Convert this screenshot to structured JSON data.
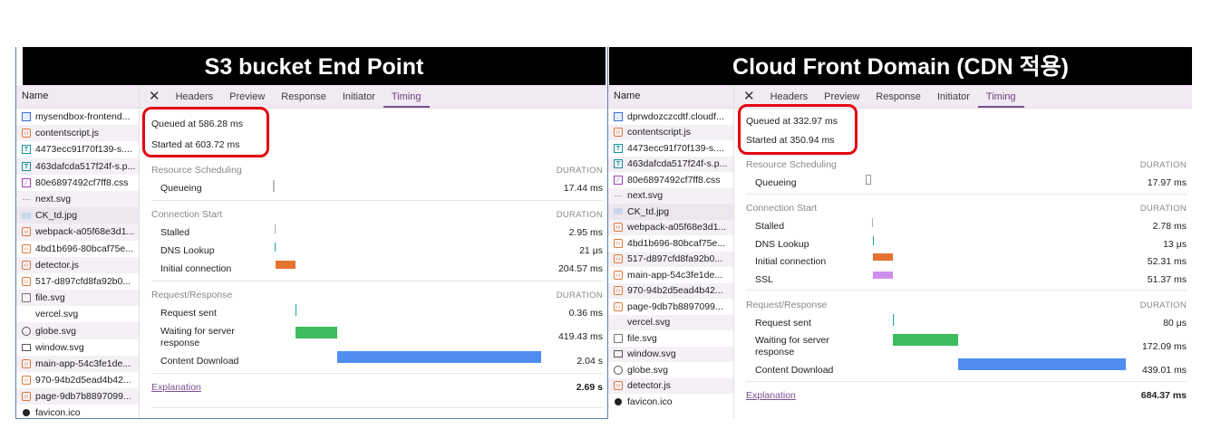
{
  "left": {
    "title": "S3 bucket End Point",
    "names_header": "Name",
    "files": [
      {
        "name": "mysendbox-frontend...",
        "icon": "document-icon"
      },
      {
        "name": "contentscript.js",
        "icon": "script-icon"
      },
      {
        "name": "4473ecc91f70f139-s....",
        "icon": "font-icon"
      },
      {
        "name": "463dafcda517f24f-s.p...",
        "icon": "font-icon"
      },
      {
        "name": "80e6897492cf7ff8.css",
        "icon": "stylesheet-icon"
      },
      {
        "name": "next.svg",
        "icon": "svg-icon"
      },
      {
        "name": "CK_td.jpg",
        "icon": "image-icon"
      },
      {
        "name": "webpack-a05f68e3d1...",
        "icon": "script-icon"
      },
      {
        "name": "4bd1b696-80bcaf75e...",
        "icon": "script-icon"
      },
      {
        "name": "detector.js",
        "icon": "script-icon"
      },
      {
        "name": "517-d897cfd8fa92b0...",
        "icon": "script-icon"
      },
      {
        "name": "file.svg",
        "icon": "file-icon"
      },
      {
        "name": "vercel.svg",
        "icon": "blank-icon"
      },
      {
        "name": "globe.svg",
        "icon": "globe-icon"
      },
      {
        "name": "window.svg",
        "icon": "window-icon"
      },
      {
        "name": "main-app-54c3fe1de...",
        "icon": "script-icon"
      },
      {
        "name": "970-94b2d5ead4b42...",
        "icon": "script-icon"
      },
      {
        "name": "page-9db7b8897099...",
        "icon": "script-icon"
      },
      {
        "name": "favicon.ico",
        "icon": "favicon-icon"
      }
    ],
    "tabs": [
      "Headers",
      "Preview",
      "Response",
      "Initiator",
      "Timing"
    ],
    "queued": "Queued at 586.28 ms",
    "started": "Started at 603.72 ms",
    "duration_label": "DURATION",
    "sections": {
      "scheduling": "Resource Scheduling",
      "connection": "Connection Start",
      "request": "Request/Response"
    },
    "timing": {
      "queueing": {
        "label": "Queueing",
        "value": "17.44 ms"
      },
      "stalled": {
        "label": "Stalled",
        "value": "2.95 ms"
      },
      "dns": {
        "label": "DNS Lookup",
        "value": "21 μs"
      },
      "initial": {
        "label": "Initial connection",
        "value": "204.57 ms"
      },
      "request_sent": {
        "label": "Request sent",
        "value": "0.36 ms"
      },
      "waiting_line1": "Waiting for server",
      "waiting_line2": "response",
      "waiting_value": "419.43 ms",
      "download": {
        "label": "Content Download",
        "value": "2.04 s"
      }
    },
    "explanation": "Explanation",
    "total": "2.69 s"
  },
  "right": {
    "title": "Cloud Front Domain (CDN 적용)",
    "names_header": "Name",
    "files": [
      {
        "name": "dprwdozczcdtf.cloudf...",
        "icon": "document-icon"
      },
      {
        "name": "contentscript.js",
        "icon": "script-icon"
      },
      {
        "name": "4473ecc91f70f139-s....",
        "icon": "font-icon"
      },
      {
        "name": "463dafcda517f24f-s.p...",
        "icon": "font-icon"
      },
      {
        "name": "80e6897492cf7ff8.css",
        "icon": "stylesheet-icon"
      },
      {
        "name": "next.svg",
        "icon": "svg-icon"
      },
      {
        "name": "CK_td.jpg",
        "icon": "image-icon"
      },
      {
        "name": "webpack-a05f68e3d1...",
        "icon": "script-icon"
      },
      {
        "name": "4bd1b696-80bcaf75e...",
        "icon": "script-icon"
      },
      {
        "name": "517-d897cfd8fa92b0...",
        "icon": "script-icon"
      },
      {
        "name": "main-app-54c3fe1de...",
        "icon": "script-icon"
      },
      {
        "name": "970-94b2d5ead4b42...",
        "icon": "script-icon"
      },
      {
        "name": "page-9db7b8897099...",
        "icon": "script-icon"
      },
      {
        "name": "vercel.svg",
        "icon": "blank-icon"
      },
      {
        "name": "file.svg",
        "icon": "file-icon"
      },
      {
        "name": "window.svg",
        "icon": "window-icon"
      },
      {
        "name": "globe.svg",
        "icon": "globe-icon"
      },
      {
        "name": "detector.js",
        "icon": "script-icon"
      },
      {
        "name": "favicon.ico",
        "icon": "favicon-icon"
      }
    ],
    "tabs": [
      "Headers",
      "Preview",
      "Response",
      "Initiator",
      "Timing"
    ],
    "queued": "Queued at 332.97 ms",
    "started": "Started at 350.94 ms",
    "duration_label": "DURATION",
    "sections": {
      "scheduling": "Resource Scheduling",
      "connection": "Connection Start",
      "request": "Request/Response"
    },
    "timing": {
      "queueing": {
        "label": "Queueing",
        "value": "17.97 ms"
      },
      "stalled": {
        "label": "Stalled",
        "value": "2.78 ms"
      },
      "dns": {
        "label": "DNS Lookup",
        "value": "13 μs"
      },
      "initial": {
        "label": "Initial connection",
        "value": "52.31 ms"
      },
      "ssl": {
        "label": "SSL",
        "value": "51.37 ms"
      },
      "request_sent": {
        "label": "Request sent",
        "value": "80 μs"
      },
      "waiting_line1": "Waiting for server",
      "waiting_line2": "response",
      "waiting_value": "172.09 ms",
      "download": {
        "label": "Content Download",
        "value": "439.01 ms"
      }
    },
    "explanation": "Explanation",
    "total": "684.37 ms"
  },
  "colors": {
    "highlight": "#e3000f",
    "initial_connection": "#e4732f",
    "ssl": "#d08ff0",
    "waiting": "#3dbd5d",
    "download": "#4f8ef0",
    "request_sent": "#1aa39a",
    "tab_active": "#7a4f8e"
  }
}
